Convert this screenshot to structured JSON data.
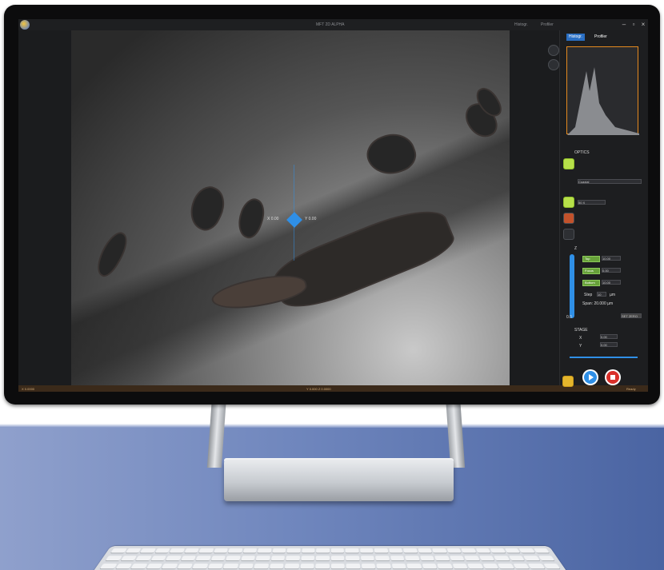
{
  "window": {
    "title": "MFT 2D ALPHA",
    "menu": [
      "Histogr.",
      "Profiler"
    ],
    "controls": [
      "minimize",
      "maximize",
      "close"
    ]
  },
  "viewport": {
    "crosshair_left_label": "X 0.00",
    "crosshair_right_label": "Y 0.00"
  },
  "panel": {
    "tabs": [
      "Histogr.",
      "Profiler"
    ],
    "optics_label": "OPTICS",
    "optics_mode": "Coaxial",
    "zoom_label": "50 X",
    "z_label": "Z",
    "z_fields": [
      {
        "label": "Top",
        "value": "10.00"
      },
      {
        "label": "Focus",
        "value": "0.00"
      },
      {
        "label": "Bottom",
        "value": "10.00"
      }
    ],
    "step_label": "Step",
    "step_value": "10",
    "step_unit": "µm",
    "span_text": "Span: 20.000 µm",
    "set_zero_label": "SET ZERO",
    "z_readout": "0.0",
    "stage_label": "STAGE",
    "stage_x_label": "X",
    "stage_x_value": "0.00",
    "stage_y_label": "Y",
    "stage_y_value": "0.00"
  },
  "statusbar": {
    "left": "X 0.0000",
    "center": "Y 0.000   Z 0.0000",
    "right": "Ready"
  },
  "colors": {
    "accent_green": "#b7e04a",
    "accent_blue": "#2f8fe6",
    "highlight_orange": "#e58a1f",
    "stop_red": "#d9302a"
  }
}
